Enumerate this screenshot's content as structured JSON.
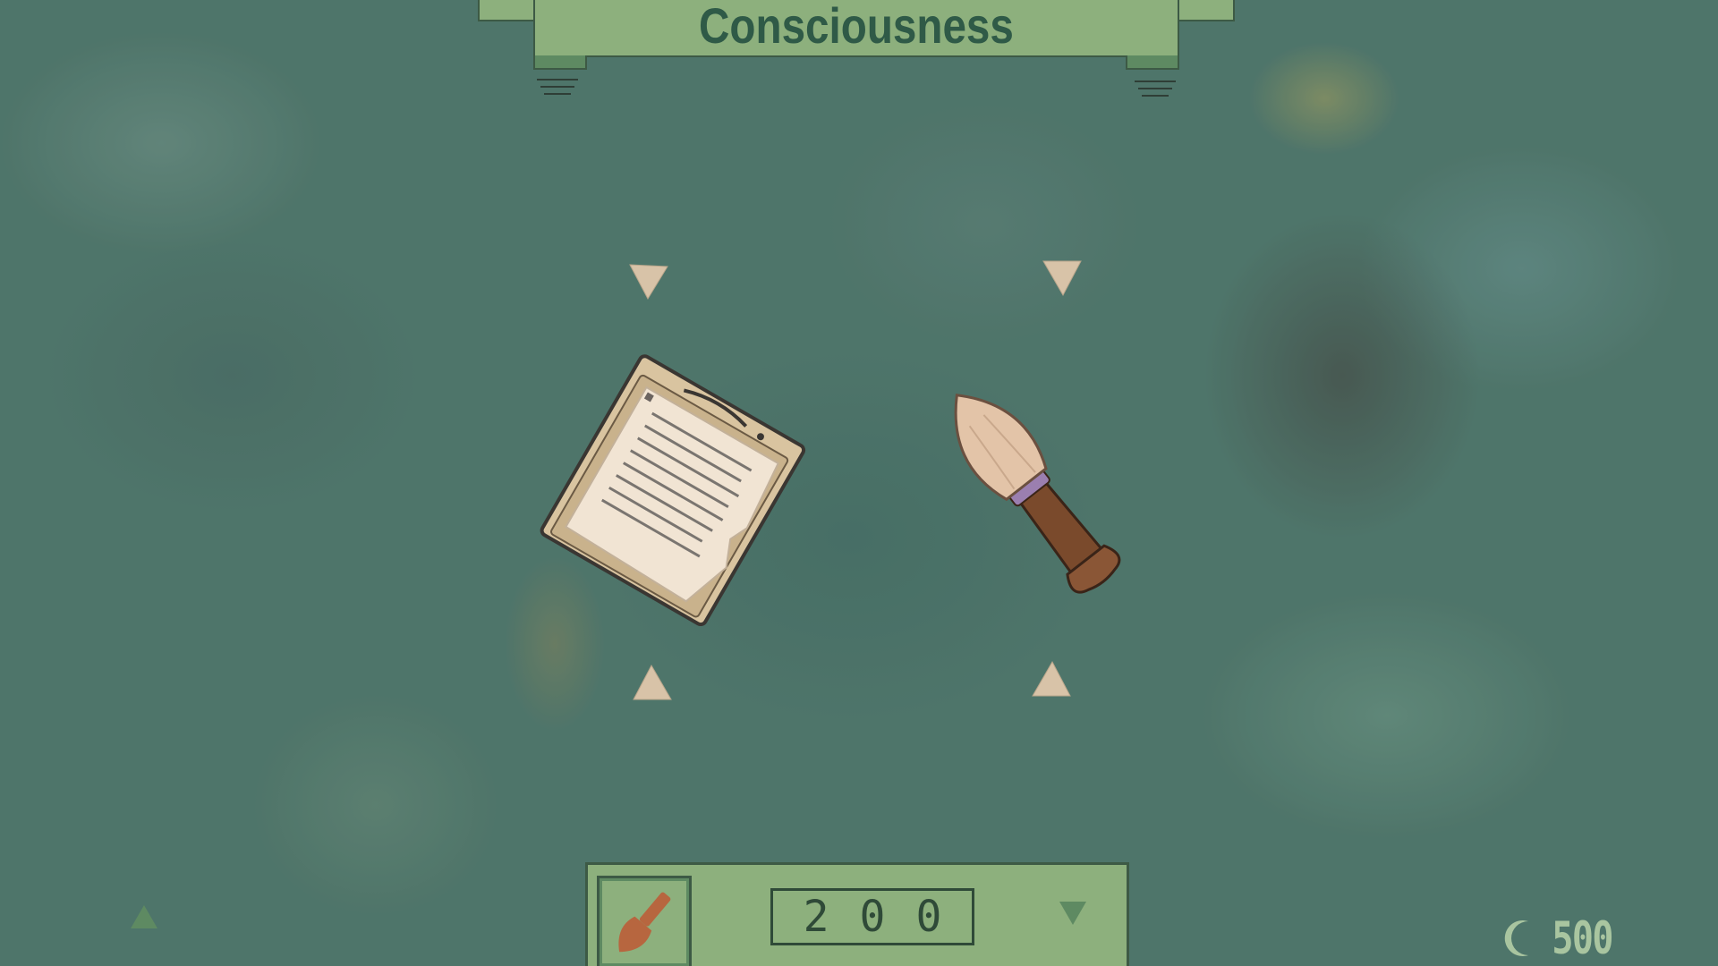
{
  "title": "Consciousness",
  "items": [
    {
      "name": "notepad",
      "icon": "notepad-icon"
    },
    {
      "name": "paintbrush",
      "icon": "paintbrush-icon"
    }
  ],
  "purchase_panel": {
    "selected_icon": "paintbrush-icon",
    "amount": "200",
    "increase_icon": "triangle-up-icon",
    "decrease_icon": "triangle-down-icon"
  },
  "currency": {
    "icon": "moon-icon",
    "value": "500"
  },
  "colors": {
    "panel": "#8db07d",
    "panel_border": "#3d5a45",
    "title_text": "#2f5a47",
    "corner_marker": "#d8c3a8",
    "currency_text": "#a9c5a0"
  }
}
